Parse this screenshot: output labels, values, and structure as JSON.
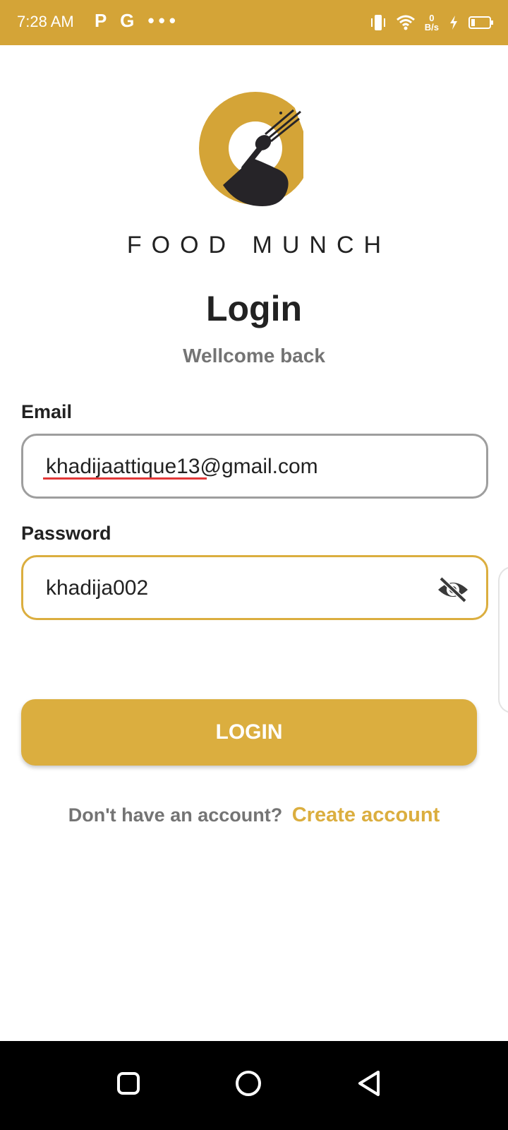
{
  "status_bar": {
    "time": "7:28 AM",
    "left_icons": [
      "p-icon",
      "google-icon",
      "more-dots-icon"
    ],
    "left_glyphs": "P G •••",
    "net_rate_value": "0",
    "net_rate_unit": "B/s",
    "right_icons": [
      "vibrate-icon",
      "wifi-icon",
      "charging-icon",
      "battery-icon"
    ]
  },
  "brand": {
    "name": "FOOD MUNCH",
    "logo_colors": {
      "gold": "#d4a437",
      "dark": "#262428"
    }
  },
  "login": {
    "title": "Login",
    "subtitle": "Wellcome back",
    "email_label": "Email",
    "email_value": "khadijaattique13@gmail.com",
    "password_label": "Password",
    "password_value": "khadija002",
    "button_label": "LOGIN",
    "no_account_text": "Don't have an account?",
    "create_account_label": "Create account"
  },
  "colors": {
    "accent": "#dbae3f",
    "status_bar": "#d4a437",
    "text_dark": "#222222",
    "text_muted": "#747474",
    "spellcheck_underline": "#e23838"
  },
  "nav_bar": {
    "icons": [
      "recents-square-icon",
      "home-circle-icon",
      "back-triangle-icon"
    ]
  }
}
